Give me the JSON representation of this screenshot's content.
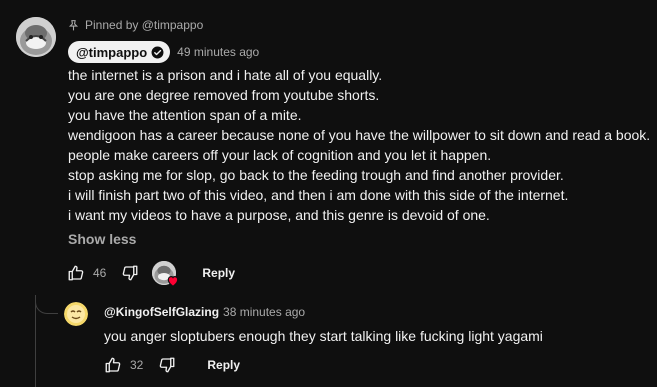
{
  "pinned_comment": {
    "pinned_label": "Pinned by @timpappo",
    "author": "@timpappo",
    "author_verified": true,
    "timestamp": "49 minutes ago",
    "lines": [
      "the internet is a prison and i hate all of you equally.",
      "you are one degree removed from youtube shorts.",
      "you have the attention span of a mite.",
      "wendigoon has a career because none of you have the willpower to sit down and read a book.",
      "people make careers off your lack of cognition and you let it happen.",
      "stop asking me for slop, go back to the feeding trough and find another provider.",
      "i will finish part two of this video, and then i am done with this side of the internet.",
      "i want my videos to have a purpose, and this genre is devoid of one."
    ],
    "show_less_label": "Show less",
    "like_count": "46",
    "reply_label": "Reply",
    "icons": {
      "pin": "pin-icon",
      "verified": "verified-check-icon",
      "like": "thumbs-up-icon",
      "dislike": "thumbs-down-icon",
      "creator_heart": "creator-heart-icon"
    }
  },
  "reply_comment": {
    "author": "@KingofSelfGlazing",
    "timestamp": "38 minutes ago",
    "text": "you anger sloptubers enough they start talking like fucking light yagami",
    "like_count": "32",
    "reply_label": "Reply"
  },
  "colors": {
    "background": "#0f0f0f",
    "primary_text": "#f1f1f1",
    "secondary_text": "#aaaaaa",
    "heart": "#ff0033",
    "thread_line": "#3f3f3f"
  }
}
